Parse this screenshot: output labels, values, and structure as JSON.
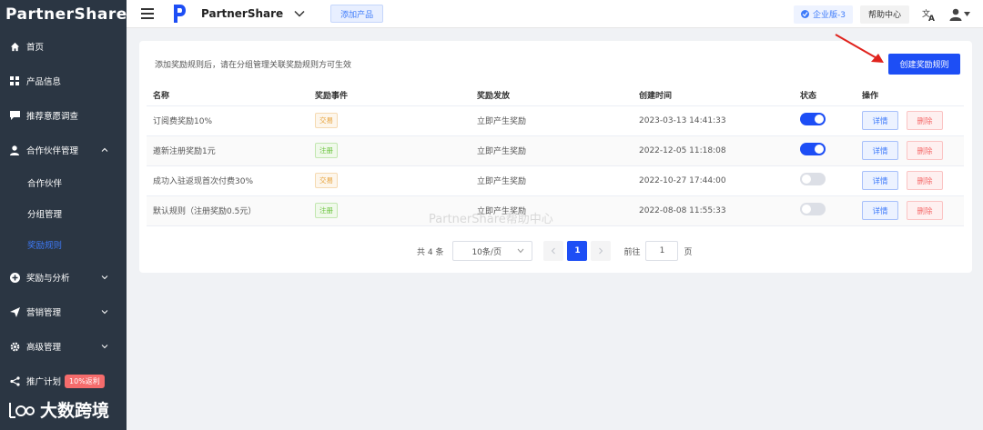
{
  "sidebar": {
    "logo": "PartnerShare",
    "items": [
      {
        "label": "首页",
        "icon": "home-icon"
      },
      {
        "label": "产品信息",
        "icon": "grid-icon"
      },
      {
        "label": "推荐意愿调查",
        "icon": "chat-icon"
      },
      {
        "label": "合作伙伴管理",
        "icon": "user-icon",
        "expanded": true
      },
      {
        "label": "奖励与分析",
        "icon": "plus-circle-icon"
      },
      {
        "label": "营销管理",
        "icon": "send-icon"
      },
      {
        "label": "高级管理",
        "icon": "gear-icon"
      },
      {
        "label": "推广计划",
        "icon": "share-icon",
        "badge": "10%返利"
      }
    ],
    "sub_items": [
      {
        "label": "合作伙伴",
        "active": false
      },
      {
        "label": "分组管理",
        "active": false
      },
      {
        "label": "奖励规则",
        "active": true
      }
    ]
  },
  "header": {
    "brand": "PartnerShare",
    "add_product": "添加产品",
    "edition": "企业版-3",
    "help": "帮助中心"
  },
  "main": {
    "notice": "添加奖励规则后，请在分组管理关联奖励规则方可生效",
    "create_button": "创建奖励规则",
    "columns": [
      "名称",
      "奖励事件",
      "奖励发放",
      "创建时间",
      "状态",
      "操作"
    ],
    "rows": [
      {
        "name": "订阅费奖励10%",
        "event": "交易",
        "event_type": "trade",
        "payout": "立即产生奖励",
        "created": "2023-03-13 14:41:33",
        "enabled": true
      },
      {
        "name": "邀新注册奖励1元",
        "event": "注册",
        "event_type": "reg",
        "payout": "立即产生奖励",
        "created": "2022-12-05 11:18:08",
        "enabled": true
      },
      {
        "name": "成功入驻返现首次付费30%",
        "event": "交易",
        "event_type": "trade",
        "payout": "立即产生奖励",
        "created": "2022-10-27 17:44:00",
        "enabled": false
      },
      {
        "name": "默认规则（注册奖励0.5元）",
        "event": "注册",
        "event_type": "reg",
        "payout": "立即产生奖励",
        "created": "2022-08-08 11:55:33",
        "enabled": false
      }
    ],
    "detail_label": "详情",
    "delete_label": "删除",
    "watermark": "PartnerShare帮助中心"
  },
  "pagination": {
    "total": "共 4 条",
    "page_size": "10条/页",
    "current_page": "1",
    "goto_label": "前往",
    "goto_value": "1",
    "page_suffix": "页"
  },
  "footer_watermark": "大数跨境",
  "colors": {
    "accent": "#1d4ef5",
    "sidebar_bg": "#2b3643",
    "active_sub": "#3e7bfa",
    "danger": "#f56c6c"
  }
}
